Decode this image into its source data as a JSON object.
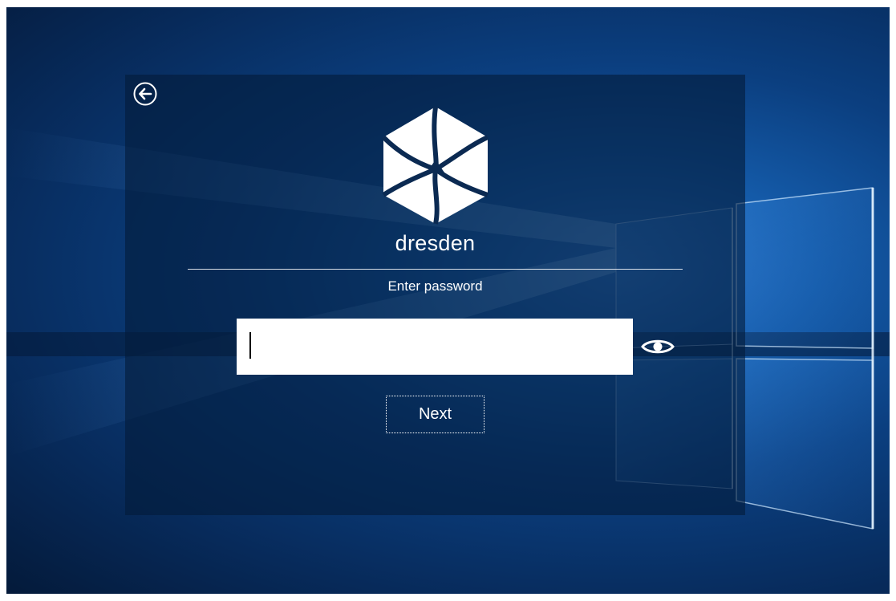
{
  "login": {
    "username": "dresden",
    "prompt": "Enter password",
    "password_value": "",
    "next_label": "Next"
  },
  "icons": {
    "back": "back-arrow-icon",
    "logo": "hexagon-logo",
    "reveal": "eye-icon"
  },
  "colors": {
    "panel": "#031c3a",
    "wallpaper_accent": "#2a74c9",
    "text": "#ffffff",
    "input_bg": "#ffffff"
  }
}
